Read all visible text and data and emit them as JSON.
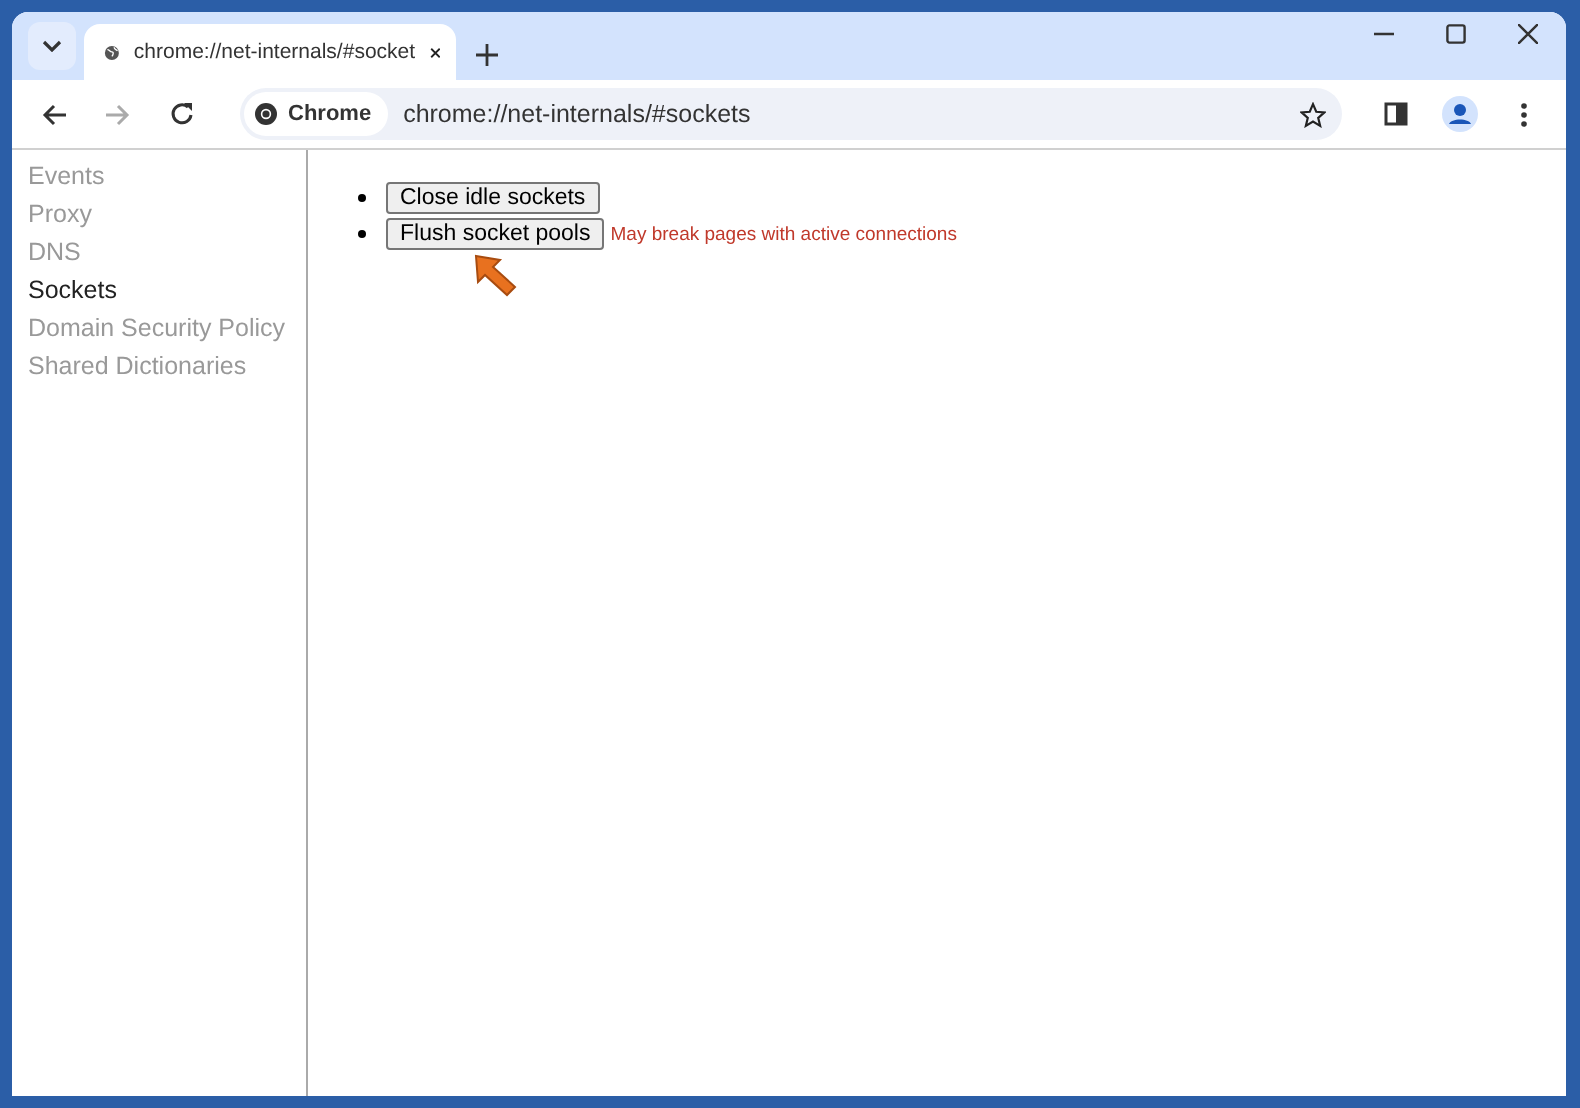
{
  "tab": {
    "title": "chrome://net-internals/#socket"
  },
  "address_bar": {
    "chip": "Chrome",
    "url": "chrome://net-internals/#sockets"
  },
  "sidebar": {
    "items": [
      {
        "label": "Events",
        "selected": false
      },
      {
        "label": "Proxy",
        "selected": false
      },
      {
        "label": "DNS",
        "selected": false
      },
      {
        "label": "Sockets",
        "selected": true
      },
      {
        "label": "Domain Security Policy",
        "selected": false
      },
      {
        "label": "Shared Dictionaries",
        "selected": false
      }
    ]
  },
  "actions": [
    {
      "label": "Close idle sockets"
    },
    {
      "label": "Flush socket pools",
      "note": "May break pages with active connections",
      "pointer": true
    }
  ]
}
